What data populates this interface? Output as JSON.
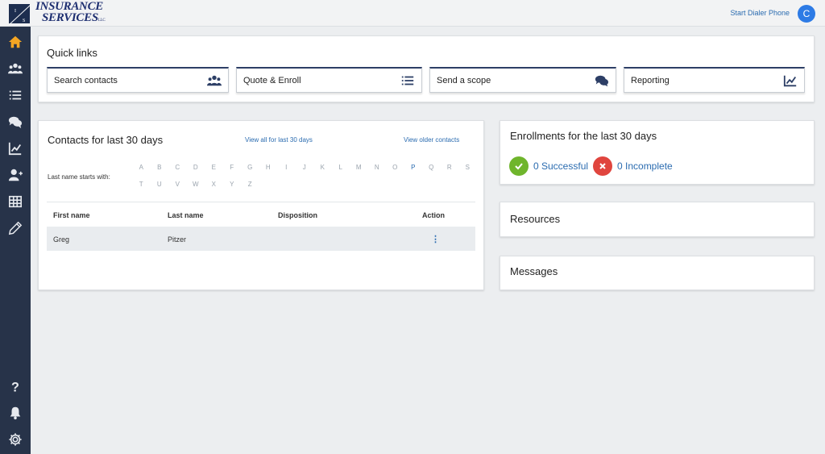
{
  "app": {
    "logo": {
      "line1": "INSURANCE",
      "line2": "SERVICES",
      "suffix": "LLC",
      "mark": "IS"
    },
    "dialer_link": "Start Dialer Phone",
    "avatar_initial": "C"
  },
  "sidebar": {
    "items": [
      {
        "icon": "home-icon",
        "active": true
      },
      {
        "icon": "users-icon"
      },
      {
        "icon": "list-icon"
      },
      {
        "icon": "chat-icon"
      },
      {
        "icon": "chart-icon"
      },
      {
        "icon": "add-user-icon"
      },
      {
        "icon": "table-icon"
      },
      {
        "icon": "pen-icon"
      }
    ],
    "bottom": [
      {
        "icon": "help-icon"
      },
      {
        "icon": "bell-icon"
      },
      {
        "icon": "gear-icon"
      }
    ]
  },
  "quick_links": {
    "title": "Quick links",
    "items": [
      {
        "label": "Search contacts",
        "icon": "users-icon"
      },
      {
        "label": "Quote & Enroll",
        "icon": "list-icon"
      },
      {
        "label": "Send a scope",
        "icon": "chat-icon"
      },
      {
        "label": "Reporting",
        "icon": "chart-icon"
      }
    ]
  },
  "contacts": {
    "title": "Contacts for last 30 days",
    "view_all": "View all for last 30 days",
    "view_older": "View older contacts",
    "filter_label": "Last name starts with:",
    "letters_row1": [
      "A",
      "B",
      "C",
      "D",
      "E",
      "F",
      "G",
      "H",
      "I",
      "J",
      "K",
      "L",
      "M",
      "N",
      "O",
      "P",
      "Q",
      "R",
      "S"
    ],
    "letters_row2": [
      "T",
      "U",
      "V",
      "W",
      "X",
      "Y",
      "Z"
    ],
    "active_letter": "P",
    "columns": {
      "first": "First name",
      "last": "Last name",
      "disposition": "Disposition",
      "action": "Action"
    },
    "rows": [
      {
        "first": "Greg",
        "last": "Pitzer",
        "disposition": "",
        "action": "⋮"
      }
    ]
  },
  "enrollments": {
    "title": "Enrollments for the last 30 days",
    "successful": "0 Successful",
    "incomplete": "0 Incomplete",
    "success_color": "#6fb52c",
    "fail_color": "#e0453e"
  },
  "resources": {
    "title": "Resources"
  },
  "messages": {
    "title": "Messages"
  },
  "colors": {
    "sidebar": "#273349",
    "accent": "#2b6cb0",
    "active_icon": "#f5a623"
  }
}
